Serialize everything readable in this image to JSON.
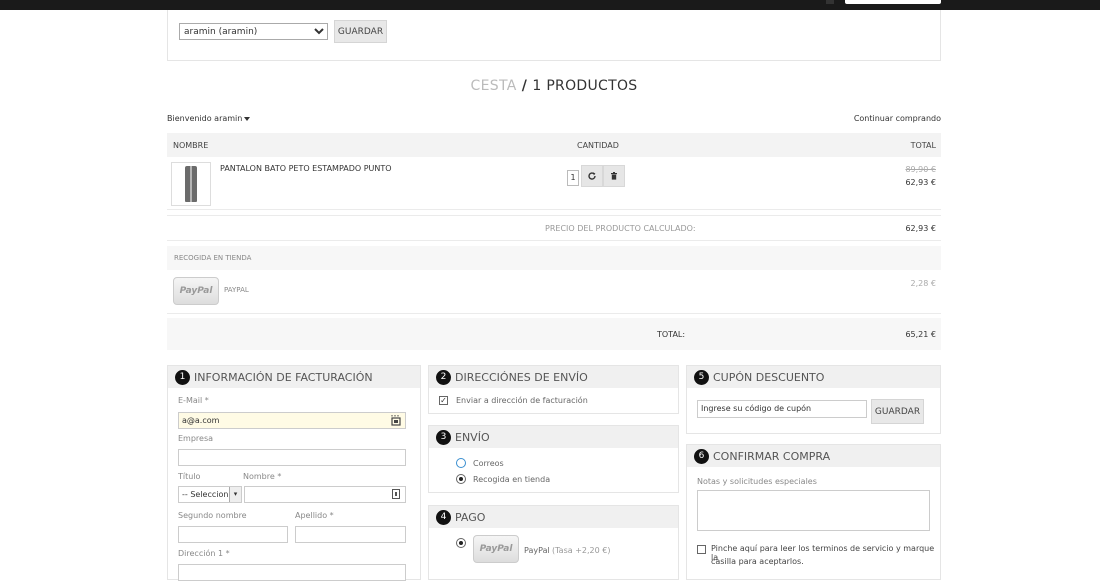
{
  "user_select": {
    "value": "aramin (aramin)",
    "save_label": "GUARDAR"
  },
  "cart_title": {
    "part1": "CESTA",
    "sep": " / ",
    "part2": "1 PRODUCTOS"
  },
  "welcome": "Bienvenido aramin",
  "continue_label": "Continuar comprando",
  "table": {
    "headers": {
      "name": "NOMBRE",
      "qty": "CANTIDAD",
      "total": "TOTAL"
    },
    "product": {
      "name": "PANTALON BATO PETO ESTAMPADO PUNTO",
      "quantity": "1",
      "price_old": "89,90 €",
      "price_new": "62,93 €"
    },
    "calc_label": "PRECIO DEL PRODUCTO CALCULADO:",
    "calc_value": "62,93 €",
    "store_pickup": "RECOGIDA EN TIENDA",
    "paypal_badge": "PayPal",
    "paypal_label": "PAYPAL",
    "paypal_fee": "2,28 €",
    "total_label": "TOTAL:",
    "total_value": "65,21 €"
  },
  "billing": {
    "number": "1",
    "title": "INFORMACIÓN DE FACTURACIÓN",
    "email_label": "E-Mail *",
    "email_value": "a@a.com",
    "company_label": "Empresa",
    "title_label": "Título",
    "title_select": "-- Seleccion",
    "first_name_label": "Nombre *",
    "middle_name_label": "Segundo nombre",
    "last_name_label": "Apellido *",
    "address1_label": "Dirección 1 *"
  },
  "shipping_addr": {
    "number": "2",
    "title": "DIRECCIÓNES DE ENVÍO",
    "checkbox_label": "Enviar a dirección de facturación"
  },
  "shipping": {
    "number": "3",
    "title": "ENVÍO",
    "options": [
      "Correos",
      "Recogida en tienda"
    ]
  },
  "payment": {
    "number": "4",
    "title": "PAGO",
    "badge": "PayPal",
    "label": "PayPal",
    "fee": "(Tasa +2,20 €)"
  },
  "coupon": {
    "number": "5",
    "title": "CUPÓN DESCUENTO",
    "value": "Ingrese su código de cupón",
    "save_label": "GUARDAR"
  },
  "confirm": {
    "number": "6",
    "title": "CONFIRMAR COMPRA",
    "notes_label": "Notas y solicitudes especiales",
    "terms_line1": "Pinche aquí para leer los terminos de servicio y marque la",
    "terms_line2": "casilla para aceptarlos."
  }
}
